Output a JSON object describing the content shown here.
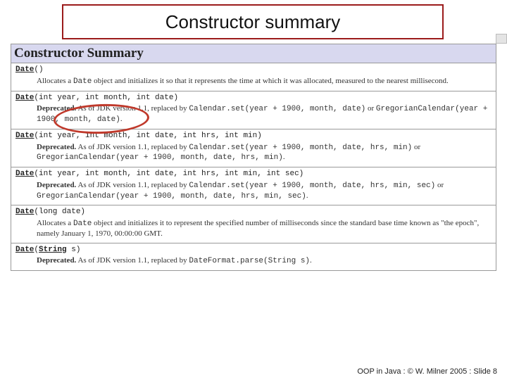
{
  "slide": {
    "title": "Constructor summary",
    "footer": "OOP in Java : © W. Milner 2005 : Slide 8"
  },
  "javadoc": {
    "header": "Constructor Summary",
    "rows": [
      {
        "sig_link": "Date",
        "sig_rest": "()",
        "desc_prefix": "Allocates a ",
        "desc_mono1": "Date",
        "desc_middle": " object and initializes it so that it represents the time at which it was allocated, measured to the nearest millisecond."
      },
      {
        "sig_link": "Date",
        "sig_rest": "(int year, int month, int date)",
        "dep_label": "Deprecated.",
        "dep_text_a": " As of JDK version 1.1, replaced by ",
        "dep_mono_a": "Calendar.set(year + 1900, month, date)",
        "dep_text_b": " or ",
        "dep_mono_b": "GregorianCalendar(year + 1900, month, date)",
        "dep_text_c": "."
      },
      {
        "sig_link": "Date",
        "sig_rest": "(int year, int month, int date, int hrs, int min)",
        "dep_label": "Deprecated.",
        "dep_text_a": " As of JDK version 1.1, replaced by ",
        "dep_mono_a": "Calendar.set(year + 1900, month, date, hrs, min)",
        "dep_text_b": " or ",
        "dep_mono_b": "GregorianCalendar(year + 1900, month, date, hrs, min)",
        "dep_text_c": "."
      },
      {
        "sig_link": "Date",
        "sig_rest": "(int year, int month, int date, int hrs, int min, int sec)",
        "dep_label": "Deprecated.",
        "dep_text_a": " As of JDK version 1.1, replaced by ",
        "dep_mono_a": "Calendar.set(year + 1900, month, date, hrs, min, sec)",
        "dep_text_b": " or ",
        "dep_mono_b": "GregorianCalendar(year + 1900, month, date, hrs, min, sec)",
        "dep_text_c": "."
      },
      {
        "sig_link": "Date",
        "sig_rest": "(long date)",
        "desc_prefix": "Allocates a ",
        "desc_mono1": "Date",
        "desc_middle": " object and initializes it to represent the specified number of milliseconds since the standard base time known as \"the epoch\", namely January 1, 1970, 00:00:00 GMT."
      },
      {
        "sig_link": "Date",
        "sig_rest_a": "(",
        "sig_type_link": "String",
        "sig_rest_b": " s)",
        "dep_label": "Deprecated.",
        "dep_text_a": " As of JDK version 1.1, replaced by ",
        "dep_mono_a": "DateFormat.parse(String s)",
        "dep_text_c": "."
      }
    ]
  }
}
